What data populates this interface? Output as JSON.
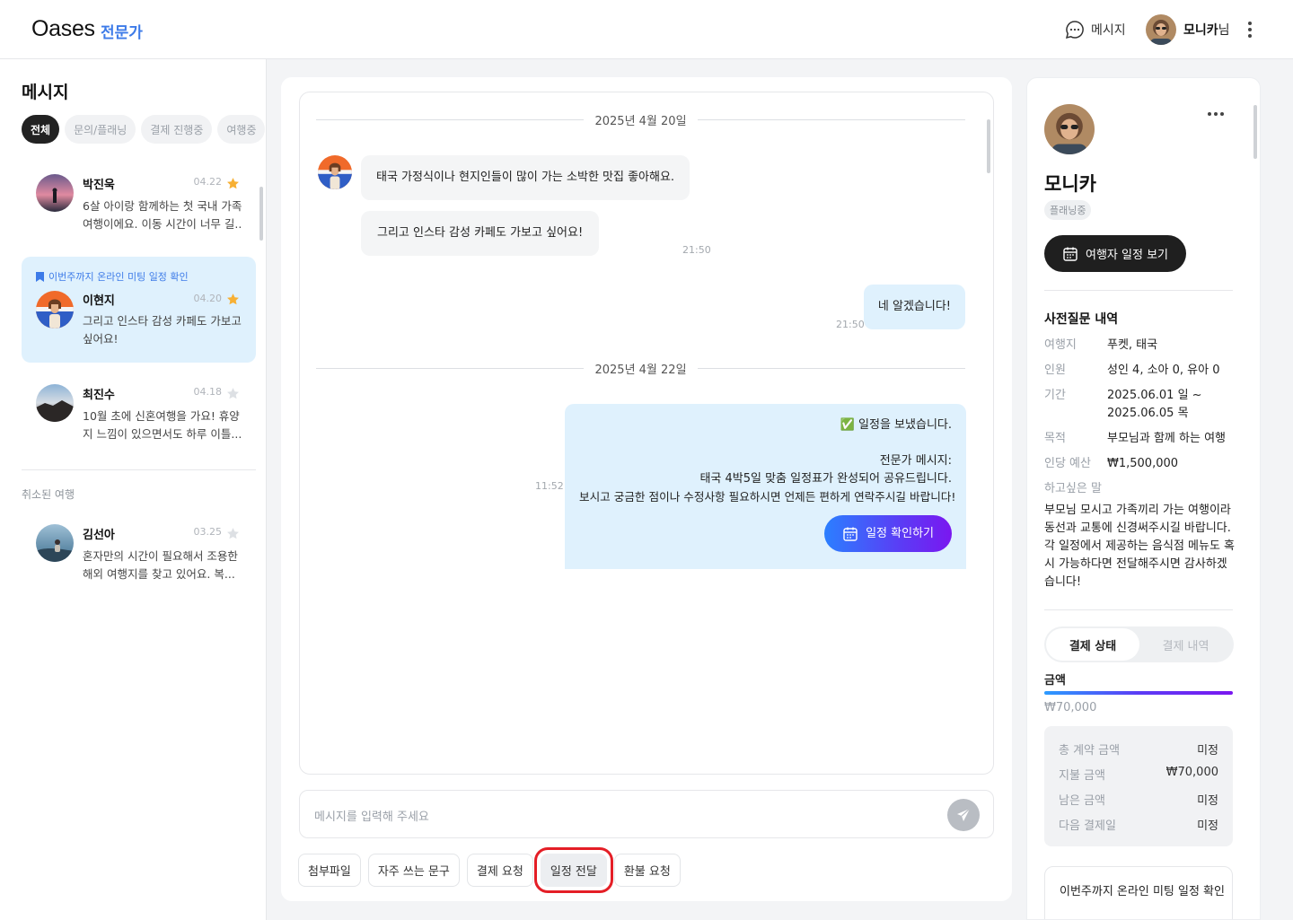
{
  "header": {
    "logo": "Oases",
    "logo_sub": "전문가",
    "message_label": "메시지",
    "user_name": "모니카",
    "user_suffix": "님"
  },
  "sidebar": {
    "title": "메시지",
    "filters": [
      "전체",
      "문의/플래닝",
      "결제 진행중",
      "여행중"
    ],
    "active_filter": "전체",
    "conversations": [
      {
        "name": "박진욱",
        "date": "04.22",
        "starred": true,
        "preview": "6살 아이랑 함께하는 첫 국내 가족여행이에요. 이동 시간이 너무 길..",
        "selected": false
      },
      {
        "name": "이현지",
        "date": "04.20",
        "starred": true,
        "pin": "이번주까지 온라인 미팅 일정 확인",
        "preview": "그리고 인스타 감성 카페도 가보고 싶어요!",
        "selected": true
      },
      {
        "name": "최진수",
        "date": "04.18",
        "starred": false,
        "preview": "10월 초에 신혼여행을 가요! 휴양지 느낌이 있으면서도 하루 이틀...",
        "selected": false
      }
    ],
    "cancelled_label": "취소된 여행",
    "cancelled": [
      {
        "name": "김선아",
        "date": "03.25",
        "starred": false,
        "preview": "혼자만의 시간이 필요해서 조용한 해외 여행지를 찾고 있어요. 복..."
      }
    ]
  },
  "chat": {
    "date1": "2025년 4월 20일",
    "msg1": "태국 가정식이나 현지인들이 많이 가는 소박한 맛집 좋아해요.",
    "msg2": "그리고 인스타 감성 카페도 가보고 싶어요!",
    "time1": "21:50",
    "msg3": "네 알겠습니다!",
    "time2": "21:50",
    "date2": "2025년 4월 22일",
    "sched_check": "✅",
    "sched_title": "일정을 보냈습니다.",
    "sched_line1": "전문가 메시지:",
    "sched_line2": "태국 4박5일 맞춤 일정표가 완성되어 공유드립니다.",
    "sched_line3": "보시고 궁금한 점이나 수정사항 필요하시면 언제든 편하게 연락주시길 바랍니다!",
    "sched_button": "일정 확인하기",
    "time3": "11:52",
    "input_placeholder": "메시지를 입력해 주세요",
    "actions": [
      "첨부파일",
      "자주 쓰는 문구",
      "결제 요청",
      "일정 전달",
      "환불 요청"
    ],
    "highlighted_action": "일정 전달"
  },
  "profile": {
    "name": "모니카",
    "status": "플래닝중",
    "schedule_button": "여행자 일정 보기",
    "section_title": "사전질문 내역",
    "fields": [
      {
        "k": "여행지",
        "v": "푸켓, 태국"
      },
      {
        "k": "인원",
        "v": "성인 4, 소아 0, 유아 0"
      },
      {
        "k": "기간",
        "v": "2025.06.01 일 ~ 2025.06.05 목"
      },
      {
        "k": "목적",
        "v": "부모님과 함께 하는 여행"
      },
      {
        "k": "인당 예산",
        "v": "₩1,500,000"
      }
    ],
    "memo_label": "하고싶은 말",
    "memo": "부모님 모시고 가족끼리 가는 여행이라 동선과 교통에 신경써주시길 바랍니다. 각 일정에서 제공하는 음식점 메뉴도 혹시 가능하다면 전달해주시면 감사하겠습니다!",
    "tab_on": "결제 상태",
    "tab_off": "결제 내역",
    "amount_label": "금액",
    "amount_value": "₩70,000",
    "summary": [
      {
        "k": "총 계약 금액",
        "v": "미정"
      },
      {
        "k": "지불 금액",
        "v": "₩70,000"
      },
      {
        "k": "남은 금액",
        "v": "미정"
      },
      {
        "k": "다음 결제일",
        "v": "미정"
      }
    ],
    "memo_card": "이번주까지 온라인 미팅 일정 확인"
  },
  "colors": {
    "accent": "#3d7be8",
    "selected_bg": "#dff1fd",
    "star": "#f7b034",
    "highlight": "#e41e26"
  }
}
